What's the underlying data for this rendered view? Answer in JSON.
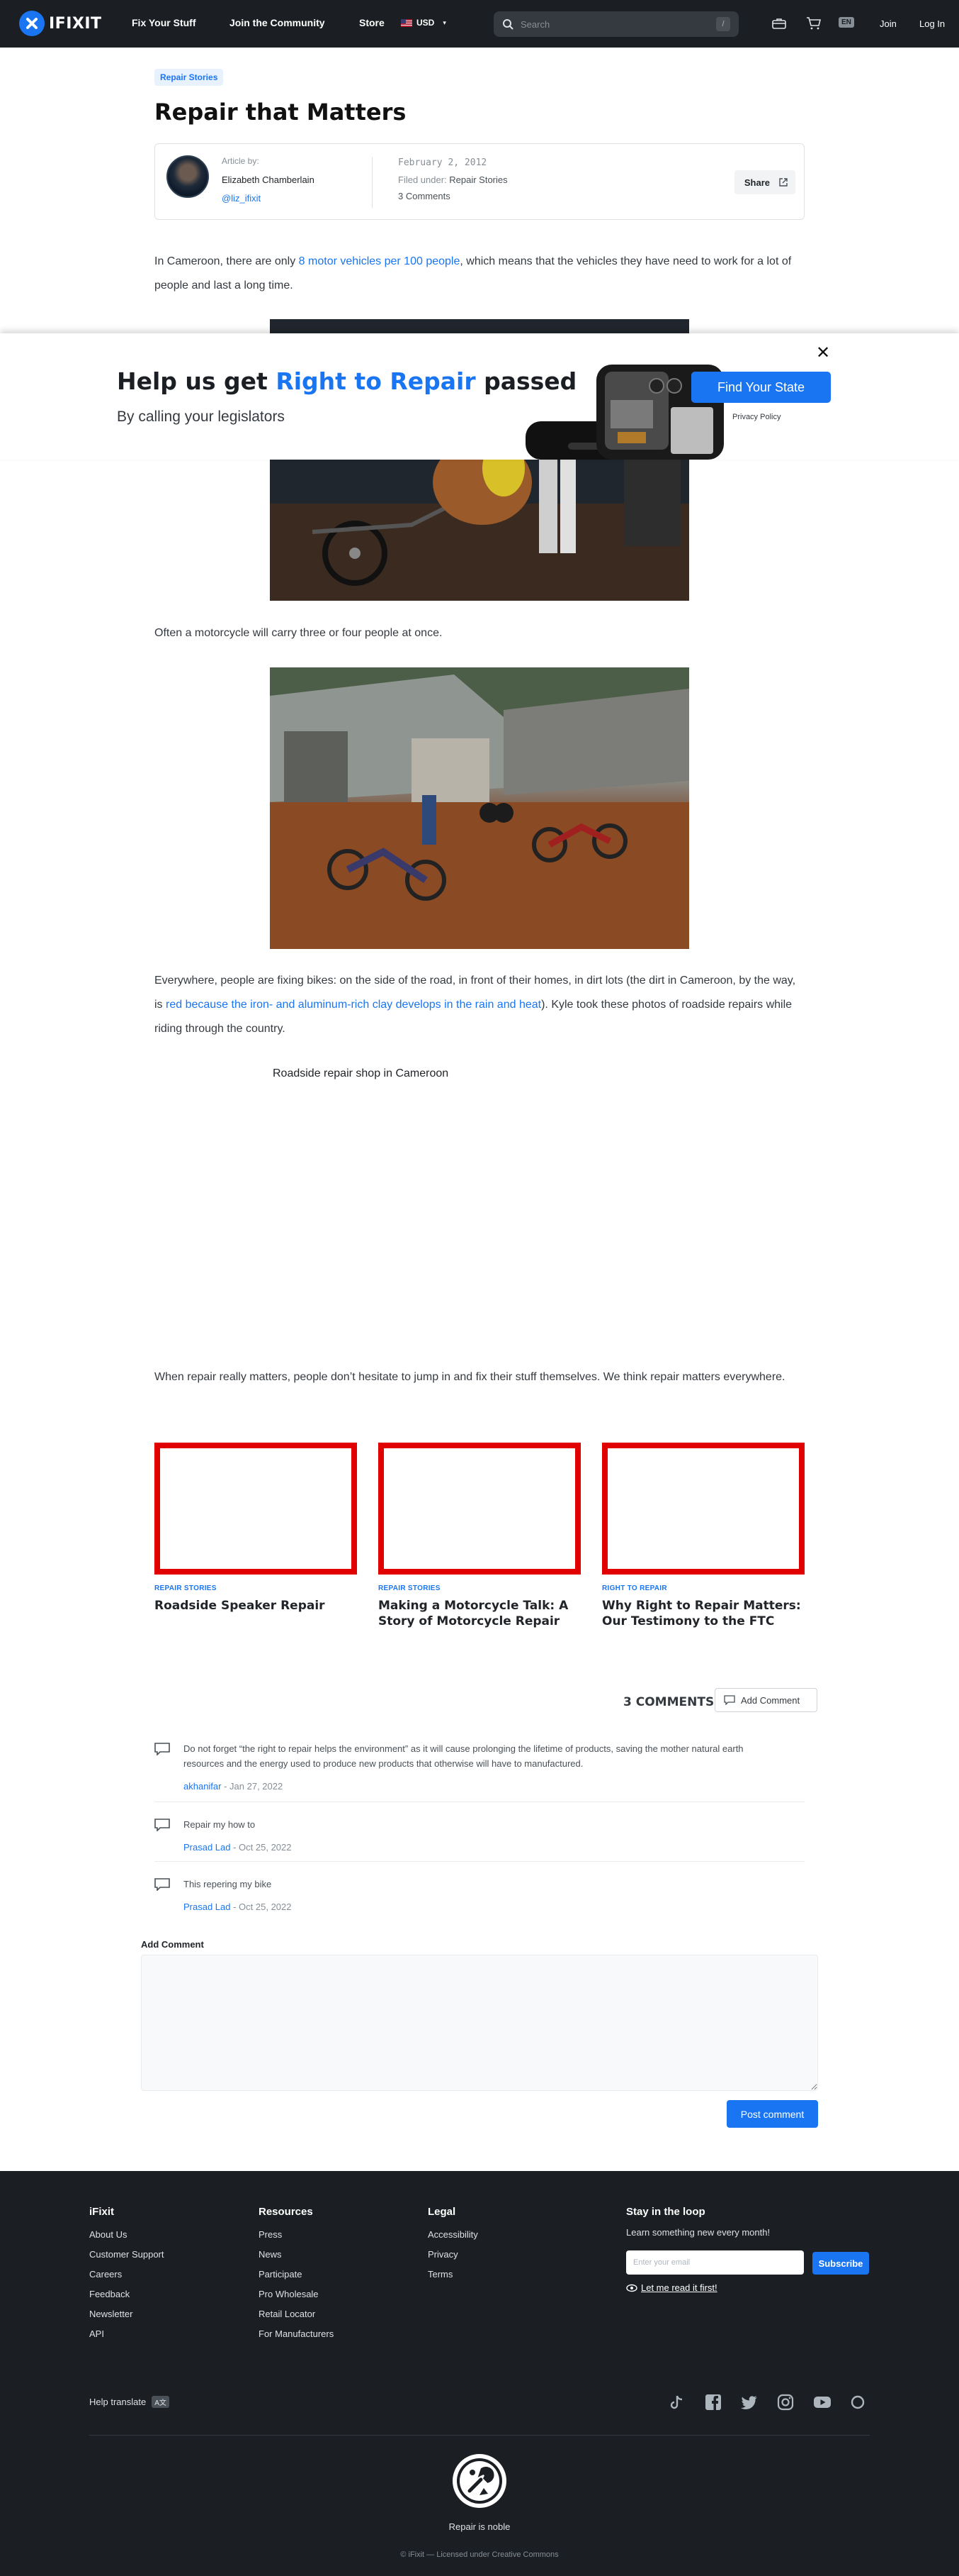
{
  "nav": {
    "logo_text": "IFIXIT",
    "fix_your_stuff": "Fix Your Stuff",
    "join_community": "Join the Community",
    "store": "Store",
    "currency": "USD",
    "search_placeholder": "Search",
    "search_shortcut": "/",
    "language": "EN",
    "join": "Join",
    "login": "Log In"
  },
  "article": {
    "tag": "Repair Stories",
    "title": "Repair that Matters",
    "meta": {
      "article_by_label": "Article by:",
      "author": "Elizabeth Chamberlain",
      "handle": "@liz_ifixit",
      "date": "February 2, 2012",
      "filed_label": "Filed under: ",
      "filed_category": "Repair Stories",
      "comments_count": "3 Comments",
      "share_label": "Share"
    },
    "p1_before": "In Cameroon, there are only ",
    "p1_link": "8 motor vehicles per 100 people",
    "p1_after": ", which means that the vehicles they have need to work for a lot of people and last a long time.",
    "p2": "Often a motorcycle will carry three or four people at once.",
    "p3_before": "Everywhere, people are fixing bikes: on the side of the road, in front of their homes, in dirt lots (the dirt in Cameroon, by the way, is ",
    "p3_link": "red because the iron- and aluminum-rich clay develops in the rain and heat",
    "p3_after": "). Kyle took these photos of roadside repairs while riding through the country.",
    "embed_caption": "Roadside repair shop in Cameroon",
    "p4": "When repair really matters, people don’t hesitate to jump in and fix their stuff themselves. We think repair matters everywhere."
  },
  "promo": {
    "title_before": "Help us get ",
    "title_highlight": "Right to Repair",
    "title_after": " passed",
    "subtitle": "By calling your legislators",
    "button": "Find Your State",
    "privacy": "Privacy Policy",
    "close": "✕"
  },
  "related": [
    {
      "tag": "REPAIR STORIES",
      "title": "Roadside Speaker Repair"
    },
    {
      "tag": "REPAIR STORIES",
      "title": "Making a Motorcycle Talk: A Story of Motorcycle Repair"
    },
    {
      "tag": "RIGHT TO REPAIR",
      "title": "Why Right to Repair Matters: Our Testimony to the FTC"
    }
  ],
  "comments": {
    "heading": "3 COMMENTS",
    "add_button": "Add Comment",
    "items": [
      {
        "text": "Do not forget “the right to repair helps the environment” as it will cause prolonging the lifetime of products, saving the mother natural earth resources and the energy used to produce new products that otherwise will have to manufactured.",
        "author": "akhanifar",
        "date": " - Jan 27, 2022"
      },
      {
        "text": "Repair my how to",
        "author": "Prasad Lad",
        "date": " - Oct 25, 2022"
      },
      {
        "text": "This repering my bike",
        "author": "Prasad Lad",
        "date": " - Oct 25, 2022"
      }
    ],
    "add_label": "Add Comment",
    "post_button": "Post comment"
  },
  "footer": {
    "ifixit_head": "iFixit",
    "ifixit_links": [
      "About Us",
      "Customer Support",
      "Careers",
      "Feedback",
      "Newsletter",
      "API"
    ],
    "resources_head": "Resources",
    "resources_links": [
      "Press",
      "News",
      "Participate",
      "Pro Wholesale",
      "Retail Locator",
      "For Manufacturers"
    ],
    "legal_head": "Legal",
    "legal_links": [
      "Accessibility",
      "Privacy",
      "Terms"
    ],
    "newsletter_head": "Stay in the loop",
    "newsletter_sub": "Learn something new every month!",
    "email_placeholder": "Enter your email",
    "subscribe": "Subscribe",
    "read_it_first": "Let me read it first!",
    "help_translate": "Help translate",
    "tagline": "Repair is noble",
    "license": "© iFixit — Licensed under Creative Commons"
  },
  "colors": {
    "accent": "#1975f2",
    "nav_bg": "#1b1f23",
    "related_border": "#e00000"
  }
}
